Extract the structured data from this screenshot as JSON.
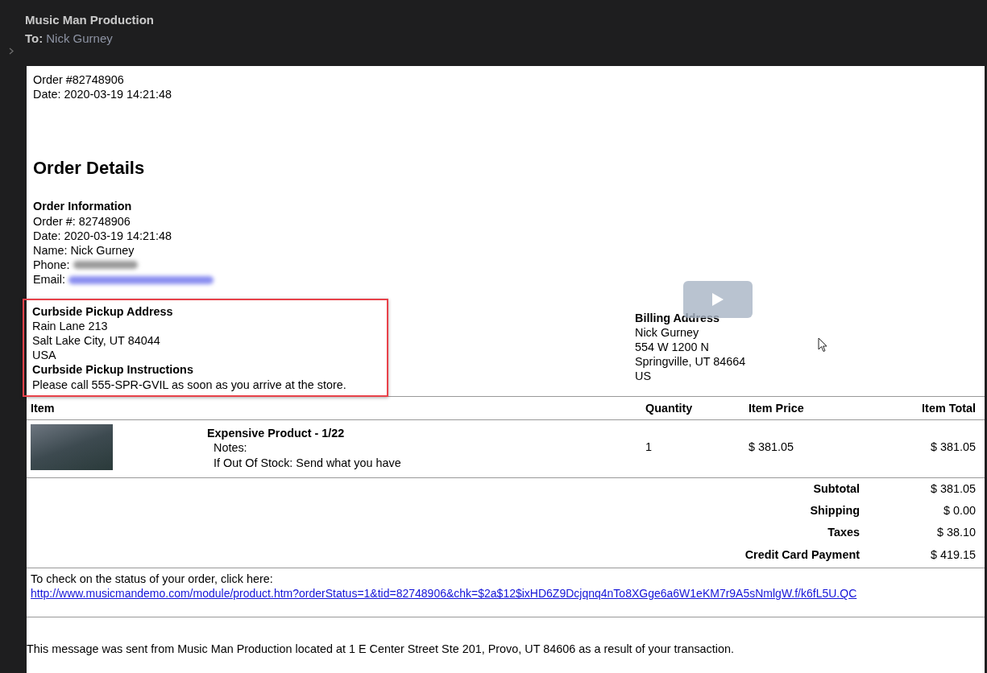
{
  "header": {
    "sender": "Music Man Production",
    "to_label": "To:",
    "to_name": "Nick Gurney"
  },
  "top": {
    "order_line": "Order #82748906",
    "date_line": "Date: 2020-03-19 14:21:48"
  },
  "heading": "Order Details",
  "order_info": {
    "title": "Order Information",
    "lines": [
      "Order #: 82748906",
      "Date: 2020-03-19 14:21:48",
      "Name: Nick Gurney"
    ],
    "phone_label": "Phone:",
    "email_label": "Email:"
  },
  "curbside": {
    "address_title": "Curbside Pickup Address",
    "address_lines": [
      "Rain Lane 213",
      "Salt Lake City, UT 84044",
      "USA"
    ],
    "instructions_title": "Curbside Pickup Instructions",
    "instructions": "Please call 555-SPR-GVIL as soon as you arrive at the store.",
    "highlighted": true
  },
  "billing": {
    "title": "Billing Address",
    "lines": [
      "Nick Gurney",
      "554 W 1200 N",
      "Springville, UT 84664",
      "US"
    ]
  },
  "table": {
    "columns": [
      "Item",
      "Quantity",
      "Item Price",
      "Item Total"
    ],
    "rows": [
      {
        "name": "Expensive Product - 1/22",
        "notes": [
          "Notes:",
          "If Out Of Stock: Send what you have"
        ],
        "quantity": "1",
        "price": "$ 381.05",
        "total": "$ 381.05"
      }
    ]
  },
  "totals": [
    {
      "label": "Subtotal",
      "value": "$ 381.05"
    },
    {
      "label": "Shipping",
      "value": "$ 0.00"
    },
    {
      "label": "Taxes",
      "value": "$ 38.10"
    },
    {
      "label": "Credit Card Payment",
      "value": "$ 419.15"
    }
  ],
  "status": {
    "text": "To check on the status of your order, click here:",
    "link": "http://www.musicmandemo.com/module/product.htm?orderStatus=1&tid=82748906&chk=$2a$12$ixHD6Z9Dcjqnq4nTo8XGge6a6W1eKM7r9A5sNmlgW.f/k6fL5U.QC"
  },
  "footer": "This message was sent from Music Man Production located at 1 E Center Street Ste 201, Provo, UT 84606 as a result of your transaction."
}
